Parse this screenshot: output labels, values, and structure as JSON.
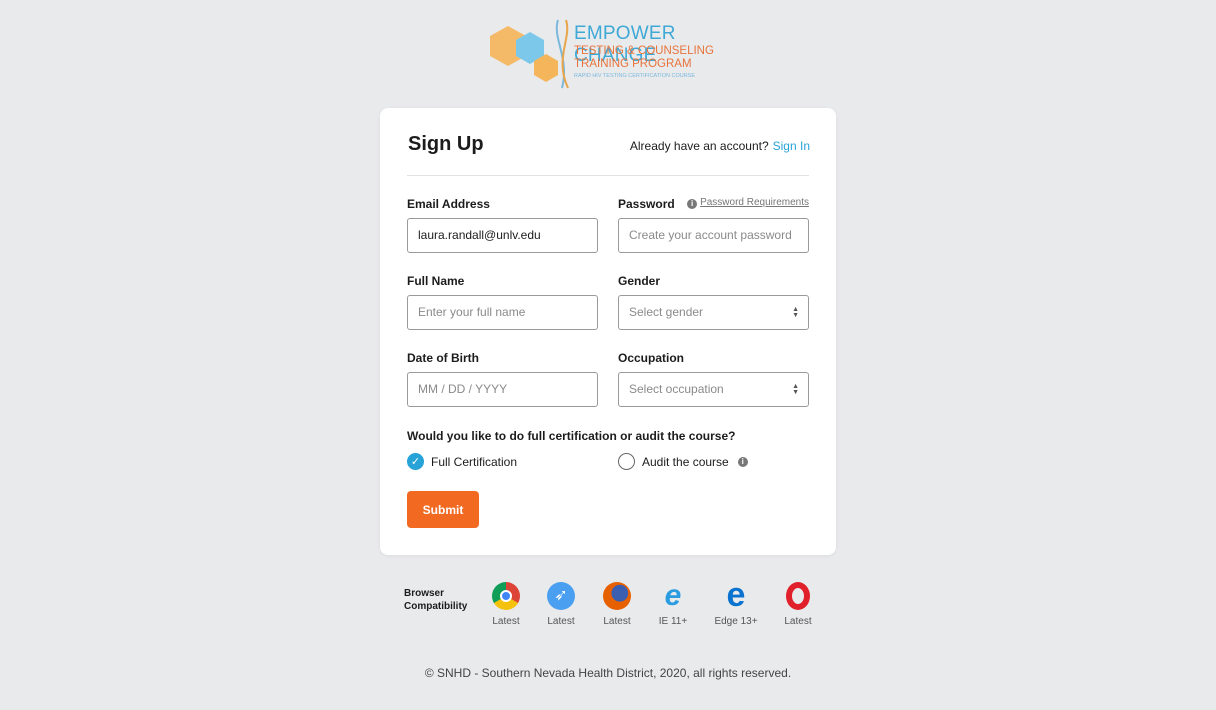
{
  "logo": {
    "title": "EMPOWER CHANGE",
    "line2": "TESTING & COUNSELING",
    "line3": "TRAINING PROGRAM",
    "tagline": "RAPID HIV TESTING CERTIFICATION COURSE"
  },
  "card": {
    "title": "Sign Up",
    "already": "Already have an account?",
    "signin": "Sign In",
    "email_label": "Email Address",
    "email_value": "laura.randall@unlv.edu",
    "password_label": "Password",
    "password_req": "Password Requirements",
    "password_placeholder": "Create your account password",
    "name_label": "Full Name",
    "name_placeholder": "Enter your full name",
    "gender_label": "Gender",
    "gender_value": "Select gender",
    "dob_label": "Date of Birth",
    "dob_placeholder": "MM / DD / YYYY",
    "occupation_label": "Occupation",
    "occupation_value": "Select occupation",
    "question": "Would you like to do full certification or audit the course?",
    "option_full": "Full Certification",
    "option_audit": "Audit the course",
    "selected": "Full Certification",
    "submit": "Submit"
  },
  "browsers": {
    "label": "Browser Compatibility",
    "items": [
      {
        "icon": "chrome-icon",
        "version": "Latest"
      },
      {
        "icon": "safari-icon",
        "version": "Latest"
      },
      {
        "icon": "firefox-icon",
        "version": "Latest"
      },
      {
        "icon": "ie-icon",
        "version": "IE 11+"
      },
      {
        "icon": "edge-icon",
        "version": "Edge 13+"
      },
      {
        "icon": "opera-icon",
        "version": "Latest"
      }
    ]
  },
  "footer": "© SNHD - Southern Nevada Health District, 2020, all rights reserved.",
  "colors": {
    "accent": "#28a3d8",
    "submit": "#f26a22"
  }
}
